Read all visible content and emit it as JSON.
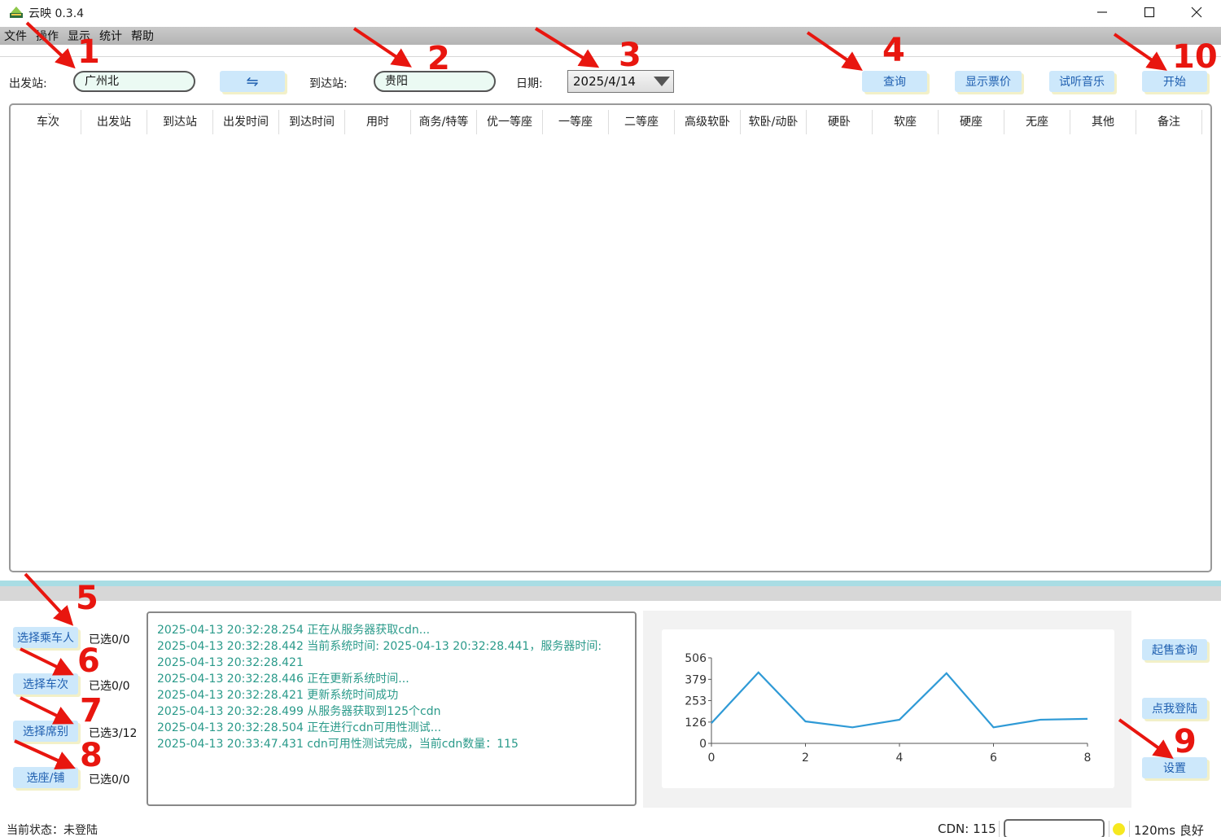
{
  "window": {
    "title": "云映 0.3.4"
  },
  "menu": [
    "文件",
    "操作",
    "显示",
    "统计",
    "帮助"
  ],
  "search": {
    "from_label": "出发站:",
    "from_value": "广州北",
    "swap_label": "⇋",
    "to_label": "到达站:",
    "to_value": "贵阳",
    "date_label": "日期:",
    "date_value": "2025/4/14",
    "query_label": "查询",
    "show_price_label": "显示票价",
    "music_label": "试听音乐",
    "start_label": "开始"
  },
  "table": {
    "columns": [
      "车次",
      "出发站",
      "到达站",
      "出发时间",
      "到达时间",
      "用时",
      "商务/特等",
      "优一等座",
      "一等座",
      "二等座",
      "高级软卧",
      "软卧/动卧",
      "硬卧",
      "软座",
      "硬座",
      "无座",
      "其他",
      "备注"
    ],
    "rows": []
  },
  "selectors": [
    {
      "label": "选择乘车人",
      "count": "已选0/0"
    },
    {
      "label": "选择车次",
      "count": "已选0/0"
    },
    {
      "label": "选择席别",
      "count": "已选3/12"
    },
    {
      "label": "选座/铺",
      "count": "已选0/0"
    }
  ],
  "log": [
    "2025-04-13 20:32:28.254 正在从服务器获取cdn...",
    "2025-04-13 20:32:28.442 当前系统时间: 2025-04-13 20:32:28.441，服务器时间:",
    "2025-04-13 20:32:28.421",
    "2025-04-13 20:32:28.446 正在更新系统时间...",
    "2025-04-13 20:32:28.421 更新系统时间成功",
    "2025-04-13 20:32:28.499 从服务器获取到125个cdn",
    "2025-04-13 20:32:28.504 正在进行cdn可用性测试...",
    "2025-04-13 20:33:47.431 cdn可用性测试完成，当前cdn数量：115"
  ],
  "chart_data": {
    "type": "line",
    "x": [
      0,
      1,
      2,
      3,
      4,
      5,
      6,
      7,
      8
    ],
    "series": [
      {
        "values": [
          120,
          420,
          130,
          95,
          140,
          415,
          95,
          140,
          145
        ]
      }
    ],
    "yticks": [
      "506",
      "379",
      "253",
      "126",
      "0"
    ],
    "xticks": [
      "0",
      "2",
      "4",
      "6",
      "8"
    ],
    "ylim": [
      0,
      506
    ],
    "xlim": [
      0,
      8
    ],
    "color": "#2f9ad6"
  },
  "right_buttons": {
    "presale_label": "起售查询",
    "login_label": "点我登陆",
    "settings_label": "设置"
  },
  "status": {
    "state": "当前状态：未登陆",
    "cdn": "CDN: 115",
    "latency": "120ms 良好"
  },
  "annotations": [
    "1",
    "2",
    "3",
    "4",
    "5",
    "6",
    "7",
    "8",
    "9",
    "10"
  ],
  "colors": {
    "accent_button": "#cde8fb",
    "annotation": "#e8160f",
    "log_text": "#2a9a8a",
    "status_dot": "#f6e81f"
  }
}
